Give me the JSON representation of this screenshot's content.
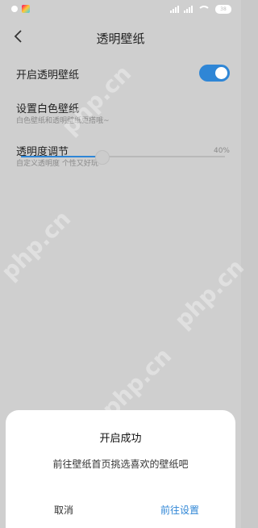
{
  "header": {
    "title": "透明壁纸"
  },
  "settings": {
    "transparent_wallpaper": {
      "label": "开启透明壁纸",
      "enabled": true
    },
    "white_wallpaper": {
      "label": "设置白色壁纸",
      "subtitle": "白色壁纸和透明壁纸更搭哦~"
    },
    "opacity": {
      "label": "透明度调节",
      "subtitle": "自定义透明度 个性又好玩",
      "value": "40%",
      "level": 0.4
    }
  },
  "status_bar": {
    "battery": "38"
  },
  "dialog": {
    "title": "开启成功",
    "message": "前往壁纸首页挑选喜欢的壁纸吧",
    "cancel": "取消",
    "confirm": "前往设置"
  },
  "watermark": "php.cn",
  "colors": {
    "accent": "#2f86d6",
    "dim_background": "#cfcfcf"
  }
}
